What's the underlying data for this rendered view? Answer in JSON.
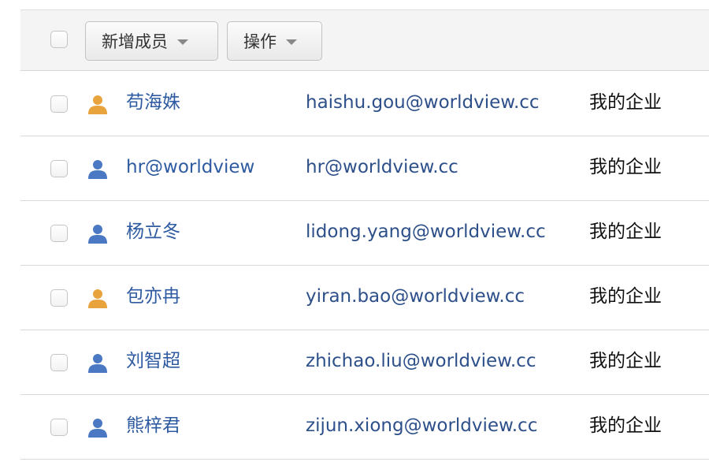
{
  "toolbar": {
    "add_member_label": "新增成员",
    "actions_label": "操作"
  },
  "members": [
    {
      "name": "苟海姝",
      "email": "haishu.gou@worldview.cc",
      "org": "我的企业",
      "avatar_color": "#e8a33c"
    },
    {
      "name": "hr@worldview",
      "email": "hr@worldview.cc",
      "org": "我的企业",
      "avatar_color": "#4a78c2"
    },
    {
      "name": "杨立冬",
      "email": "lidong.yang@worldview.cc",
      "org": "我的企业",
      "avatar_color": "#4a78c2"
    },
    {
      "name": "包亦冉",
      "email": "yiran.bao@worldview.cc",
      "org": "我的企业",
      "avatar_color": "#e8a33c"
    },
    {
      "name": "刘智超",
      "email": "zhichao.liu@worldview.cc",
      "org": "我的企业",
      "avatar_color": "#4a78c2"
    },
    {
      "name": "熊梓君",
      "email": "zijun.xiong@worldview.cc",
      "org": "我的企业",
      "avatar_color": "#4a78c2"
    }
  ]
}
